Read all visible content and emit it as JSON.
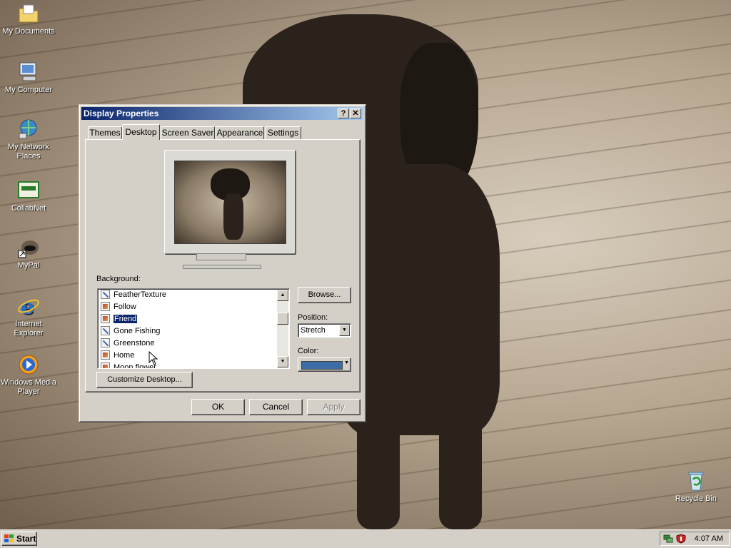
{
  "desktop": {
    "icons": [
      {
        "label": "My Documents",
        "icon": "folder-documents-icon"
      },
      {
        "label": "My Computer",
        "icon": "computer-icon"
      },
      {
        "label": "My Network Places",
        "icon": "network-icon"
      },
      {
        "label": "CollabNet",
        "icon": "collabnet-icon"
      },
      {
        "label": "MyPal",
        "icon": "mypal-icon"
      },
      {
        "label": "Internet Explorer",
        "icon": "internet-explorer-icon"
      },
      {
        "label": "Windows Media Player",
        "icon": "media-player-icon"
      },
      {
        "label": "Recycle Bin",
        "icon": "recycle-bin-icon"
      }
    ]
  },
  "dialog": {
    "title": "Display Properties",
    "help_button": "?",
    "close_button": "✕",
    "tabs": [
      {
        "label": "Themes",
        "active": false
      },
      {
        "label": "Desktop",
        "active": true
      },
      {
        "label": "Screen Saver",
        "active": false
      },
      {
        "label": "Appearance",
        "active": false
      },
      {
        "label": "Settings",
        "active": false
      }
    ],
    "background_label": "Background:",
    "background_items": [
      {
        "label": "FeatherTexture",
        "icon": "texture-file-icon",
        "selected": false
      },
      {
        "label": "Follow",
        "icon": "image-file-icon",
        "selected": false
      },
      {
        "label": "Friend",
        "icon": "image-file-icon",
        "selected": true
      },
      {
        "label": "Gone Fishing",
        "icon": "texture-file-icon",
        "selected": false
      },
      {
        "label": "Greenstone",
        "icon": "texture-file-icon",
        "selected": false
      },
      {
        "label": "Home",
        "icon": "image-file-icon",
        "selected": false
      },
      {
        "label": "Moon flower",
        "icon": "image-file-icon",
        "selected": false
      }
    ],
    "browse_button": "Browse...",
    "position_label": "Position:",
    "position_value": "Stretch",
    "color_label": "Color:",
    "color_value": "#3a6ea5",
    "customize_button": "Customize Desktop...",
    "ok_button": "OK",
    "cancel_button": "Cancel",
    "apply_button": "Apply"
  },
  "taskbar": {
    "start_label": "Start",
    "clock": "4:07 AM"
  }
}
